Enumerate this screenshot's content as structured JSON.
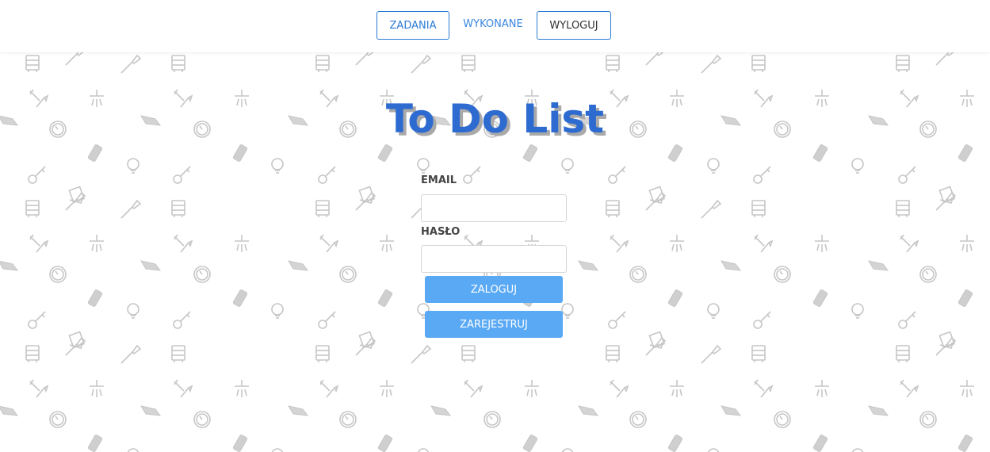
{
  "nav": {
    "tasks_label": "ZADANIA",
    "done_label": "WYKONANE",
    "logout_label": "WYLOGUJ"
  },
  "app": {
    "title": "To Do List"
  },
  "form": {
    "email_label": "EMAIL",
    "email_value": "",
    "password_label": "HASŁO",
    "password_value": "",
    "login_label": "ZALOGUJ",
    "register_label": "ZAREJESTRUJ"
  },
  "background": {
    "icons": [
      "paint-roller-icon",
      "paintbrush-icon",
      "kitchen-tools-icon",
      "sprinkler-icon",
      "sponge-icon",
      "clock-icon",
      "phone-icon",
      "lightbulb-icon",
      "key-icon",
      "note-icon"
    ]
  },
  "colors": {
    "accent": "#2b7bd6",
    "button": "#5aa9f5",
    "title": "#2e6bd1",
    "title_shadow": "#a9a9a9",
    "pattern": "#c8c8c8"
  }
}
